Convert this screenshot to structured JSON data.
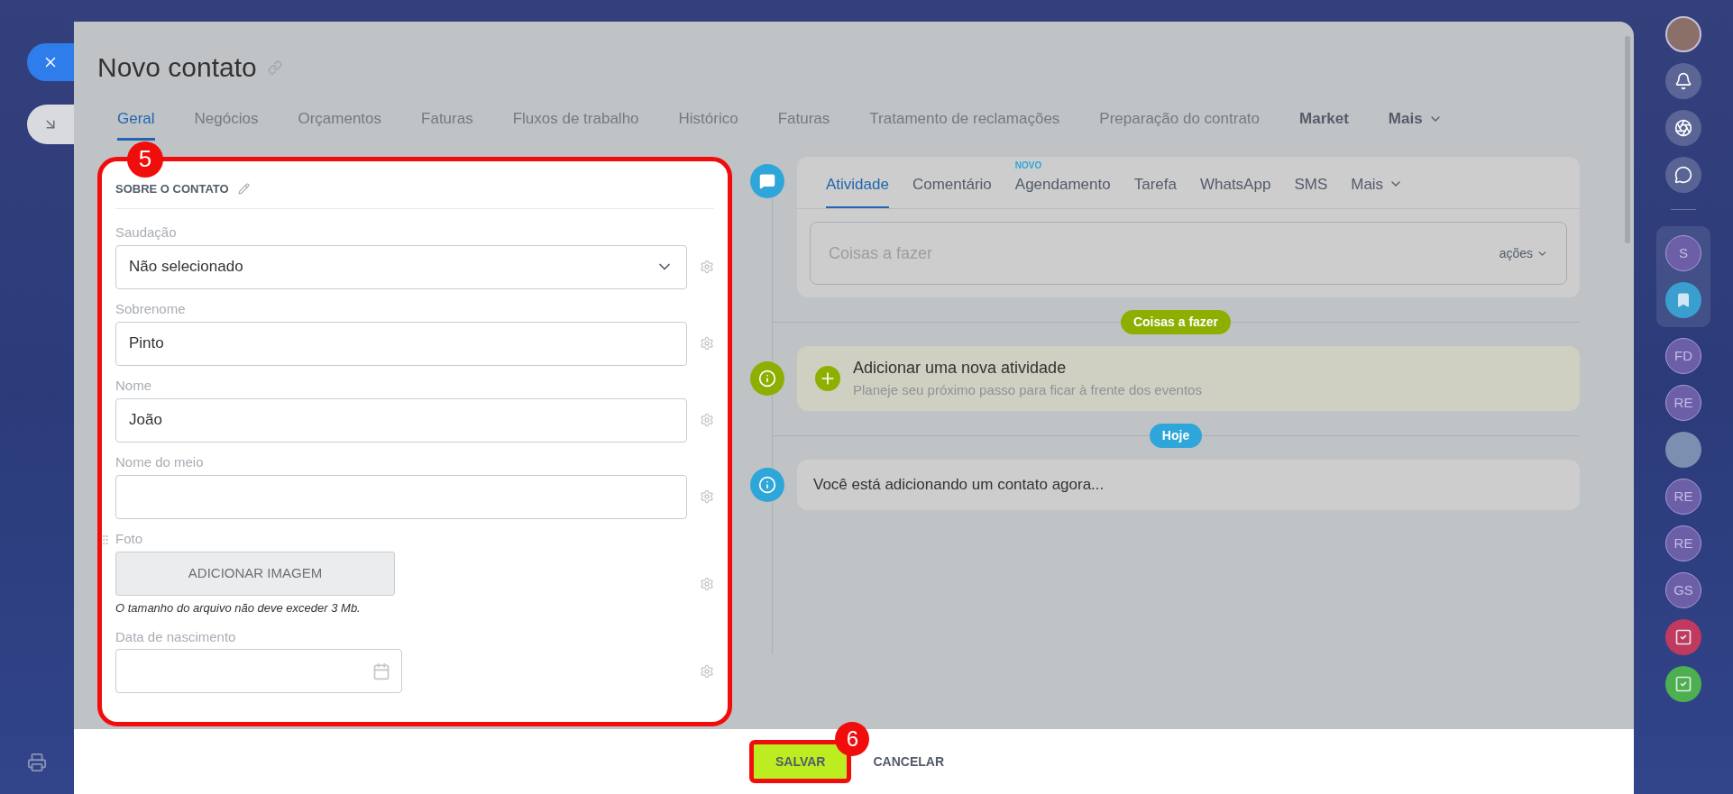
{
  "title": "Novo contato",
  "tabs": [
    {
      "label": "Geral",
      "selected": true,
      "kind": "tab"
    },
    {
      "label": "Negócios",
      "selected": false,
      "kind": "tab"
    },
    {
      "label": "Orçamentos",
      "selected": false,
      "kind": "tab"
    },
    {
      "label": "Faturas",
      "selected": false,
      "kind": "tab"
    },
    {
      "label": "Fluxos de trabalho",
      "selected": false,
      "kind": "tab"
    },
    {
      "label": "Histórico",
      "selected": false,
      "kind": "tab"
    },
    {
      "label": "Faturas",
      "selected": false,
      "kind": "tab"
    },
    {
      "label": "Tratamento de reclamações",
      "selected": false,
      "kind": "tab"
    },
    {
      "label": "Preparação do contrato",
      "selected": false,
      "kind": "tab"
    },
    {
      "label": "Market",
      "selected": false,
      "kind": "app"
    },
    {
      "label": "Mais",
      "selected": false,
      "kind": "more"
    }
  ],
  "form": {
    "badge": "5",
    "title": "SOBRE O CONTATO",
    "fields": [
      {
        "kind": "select",
        "label": "Saudação",
        "value": "Não selecionado"
      },
      {
        "kind": "text",
        "label": "Sobrenome",
        "value": "Pinto"
      },
      {
        "kind": "text",
        "label": "Nome",
        "value": "João"
      },
      {
        "kind": "text",
        "label": "Nome do meio"
      },
      {
        "kind": "image",
        "label": "Foto",
        "button": "ADICIONAR IMAGEM",
        "hint": "O tamanho do arquivo não deve exceder 3 Mb."
      },
      {
        "kind": "date",
        "label": "Data de nascimento"
      }
    ]
  },
  "timeline": {
    "tabs": [
      {
        "label": "Atividade",
        "selected": true
      },
      {
        "label": "Comentário",
        "selected": false
      },
      {
        "label": "Agendamento",
        "selected": false,
        "badge": "NOVO"
      },
      {
        "label": "Tarefa",
        "selected": false
      },
      {
        "label": "WhatsApp",
        "selected": false
      },
      {
        "label": "SMS",
        "selected": false
      },
      {
        "label": "Mais",
        "selected": false,
        "kind": "more"
      }
    ],
    "todo": {
      "placeholder": "Coisas a fazer",
      "actions": "ações"
    },
    "entries": [
      {
        "kind": "pill",
        "label": "Coisas a fazer",
        "color": "#8db000"
      },
      {
        "kind": "action",
        "title": "Adicionar uma nova atividade",
        "subtitle": "Planeje seu próximo passo para ficar à frente dos eventos",
        "color": "#8db000"
      },
      {
        "kind": "pill",
        "label": "Hoje",
        "color": "#2fa6d9"
      },
      {
        "kind": "note",
        "text": "Você está adicionando um contato agora...",
        "color": "#2fa6d9"
      }
    ]
  },
  "footer": {
    "badge": "6",
    "buttons": [
      {
        "label": "SALVAR",
        "kind": "primary"
      },
      {
        "label": "CANCELAR",
        "kind": "link"
      }
    ]
  },
  "right_rail": [
    {
      "kind": "photo"
    },
    {
      "kind": "bell"
    },
    {
      "kind": "spiral"
    },
    {
      "kind": "chat"
    },
    {
      "kind": "separator"
    },
    {
      "kind": "group",
      "children": [
        {
          "kind": "initials",
          "text": "S"
        },
        {
          "kind": "bookmark"
        }
      ]
    },
    {
      "kind": "initials",
      "text": "FD"
    },
    {
      "kind": "initials",
      "text": "RE"
    },
    {
      "kind": "avatar"
    },
    {
      "kind": "initials",
      "text": "RE"
    },
    {
      "kind": "initials",
      "text": "RE"
    },
    {
      "kind": "initials",
      "text": "GS"
    },
    {
      "kind": "task",
      "color": "#c0395e"
    },
    {
      "kind": "task",
      "color": "#4caf50"
    }
  ]
}
